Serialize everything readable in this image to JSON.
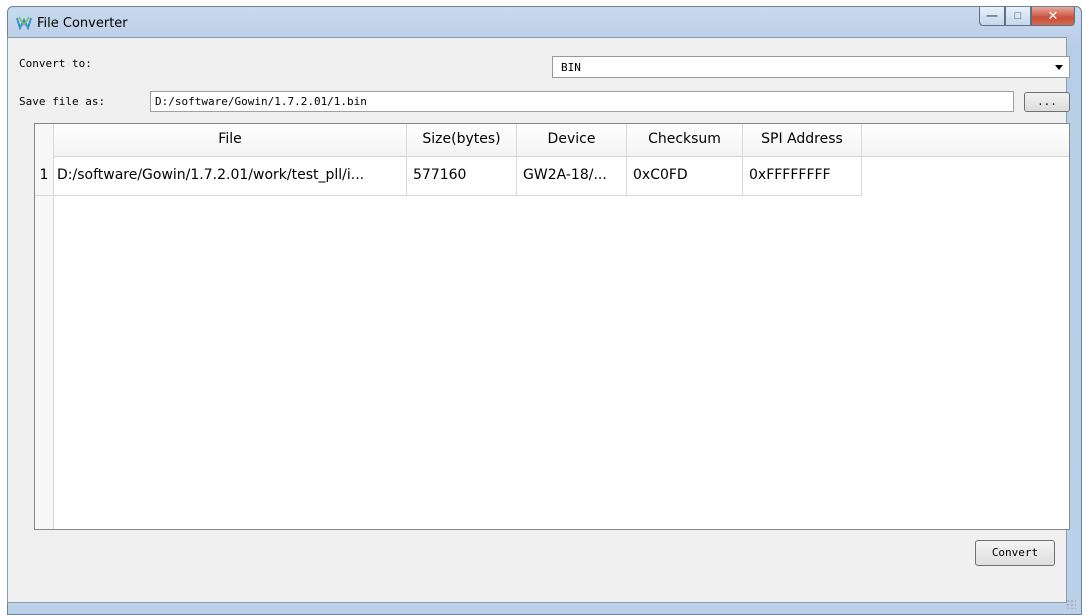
{
  "window": {
    "title": "File Converter",
    "app_icon": "gowin-logo-icon",
    "caption_buttons": {
      "minimize": "—",
      "maximize": "□",
      "close": "✕"
    }
  },
  "form": {
    "convert_to_label": "Convert to:",
    "convert_to_value": "BIN",
    "save_file_as_label": "Save file as:",
    "save_file_path": "D:/software/Gowin/1.7.2.01/1.bin",
    "browse_label": "...",
    "convert_button_label": "Convert"
  },
  "table": {
    "columns": [
      "File",
      "Size(bytes)",
      "Device",
      "Checksum",
      "SPI Address"
    ],
    "rows": [
      {
        "index": "1",
        "file": "D:/software/Gowin/1.7.2.01/work/test_pll/i...",
        "size": "577160",
        "device": "GW2A-18/...",
        "checksum": "0xC0FD",
        "spi_address": "0xFFFFFFFF"
      }
    ]
  },
  "colors": {
    "window_frame": "#b9cde6",
    "close_button": "#c7503a",
    "client_background": "#f0f0f0"
  }
}
